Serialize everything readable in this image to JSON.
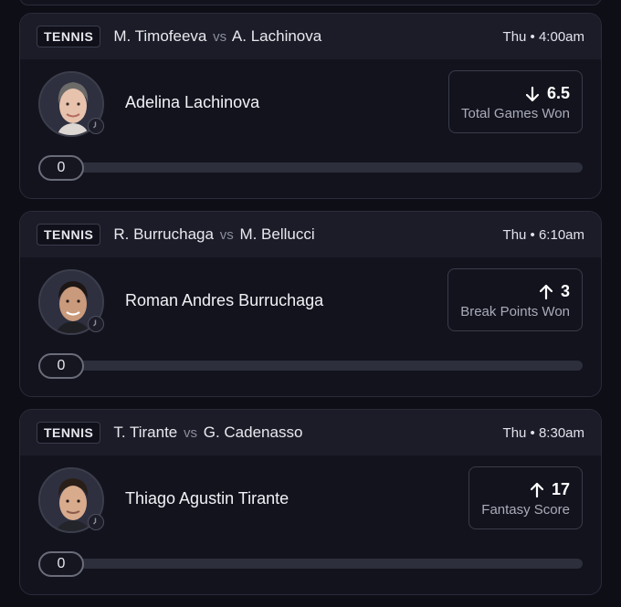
{
  "cards": [
    {
      "sport": "TENNIS",
      "player1": "M. Timofeeva",
      "vs": "vs",
      "player2": "A. Lachinova",
      "time": "Thu • 4:00am",
      "player_name": "Adelina Lachinova",
      "direction": "down",
      "line": "6.5",
      "stat": "Total Games Won",
      "progress": "0"
    },
    {
      "sport": "TENNIS",
      "player1": "R. Burruchaga",
      "vs": "vs",
      "player2": "M. Bellucci",
      "time": "Thu • 6:10am",
      "player_name": "Roman Andres Burruchaga",
      "direction": "up",
      "line": "3",
      "stat": "Break Points Won",
      "progress": "0"
    },
    {
      "sport": "TENNIS",
      "player1": "T. Tirante",
      "vs": "vs",
      "player2": "G. Cadenasso",
      "time": "Thu • 8:30am",
      "player_name": "Thiago Agustin Tirante",
      "direction": "up",
      "line": "17",
      "stat": "Fantasy Score",
      "progress": "0"
    }
  ],
  "icons": {
    "up": "arrow-up-icon",
    "down": "arrow-down-icon",
    "clock": "clock-icon",
    "avatar": "player-avatar"
  },
  "colors": {
    "background": "#0d0e16",
    "card": "#12131d",
    "header": "#1b1c28",
    "border": "#2a2c3a",
    "muted_text": "#a9abb8"
  }
}
